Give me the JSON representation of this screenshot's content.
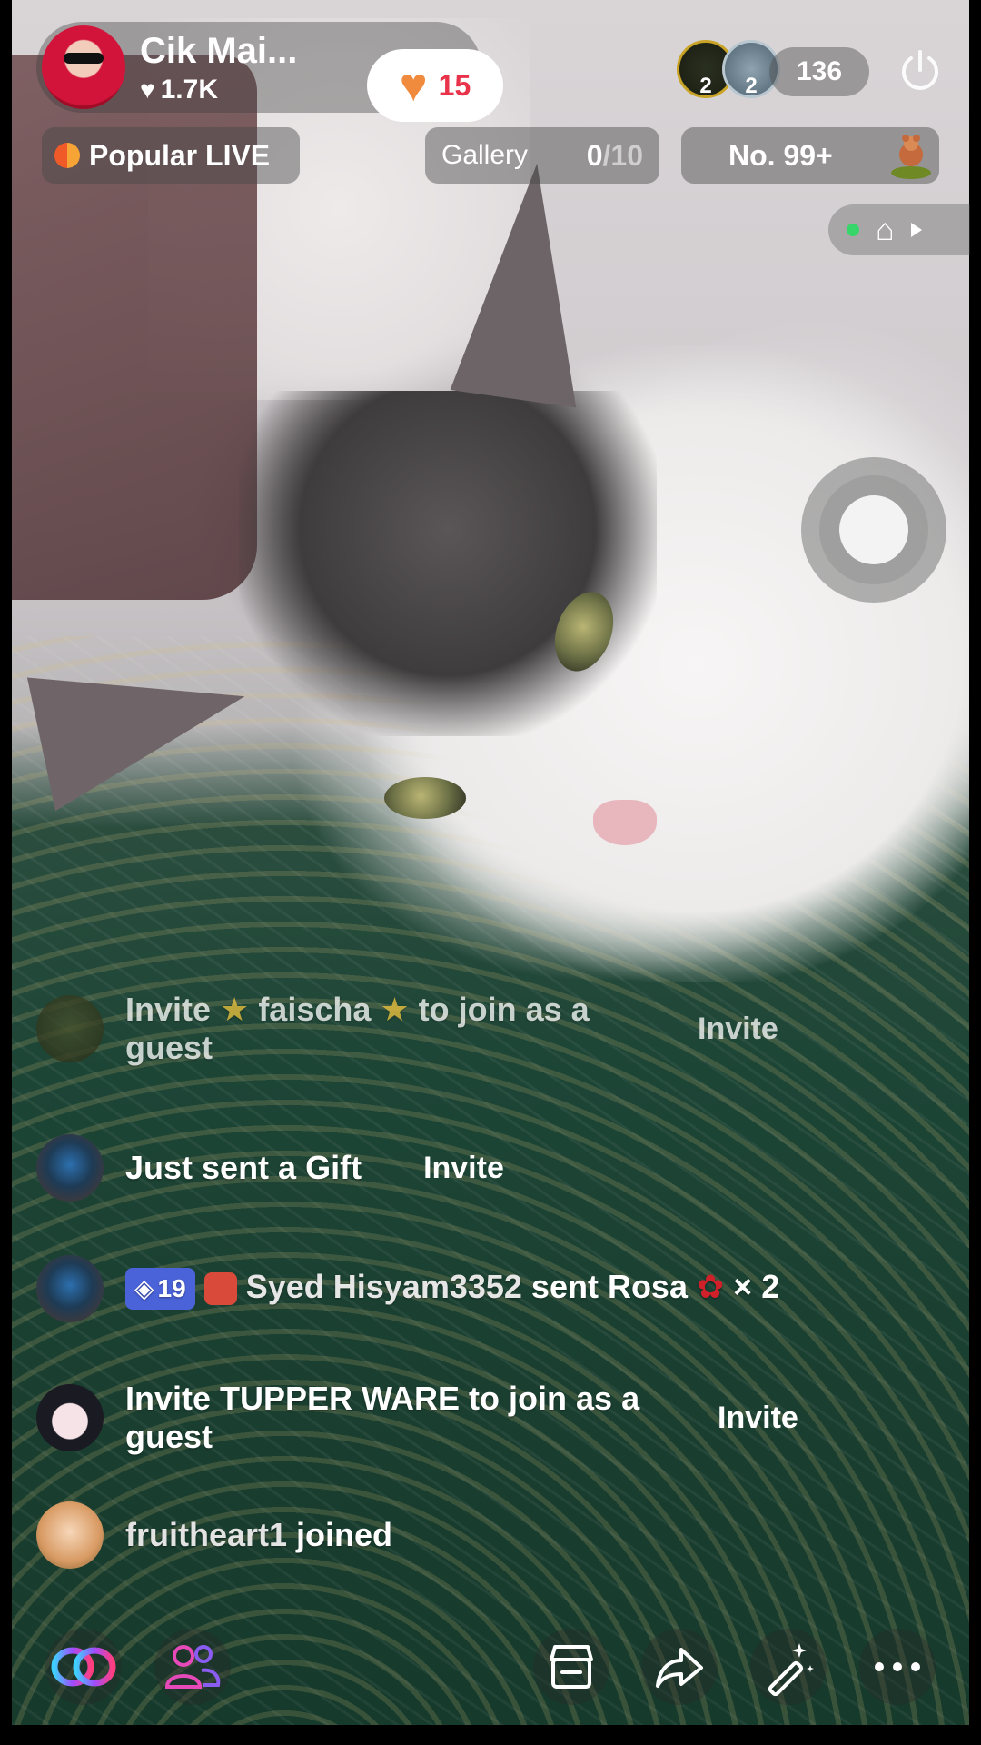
{
  "host": {
    "name": "Cik Mai...",
    "likes": "1.7K",
    "follow_count": "15"
  },
  "viewers": {
    "top1_rank": "2",
    "top2_rank": "2",
    "count": "136"
  },
  "chips": {
    "popular_label": "Popular LIVE",
    "gallery_label": "Gallery",
    "gallery_current": "0",
    "gallery_total": "/10",
    "rank_label": "No. 99+"
  },
  "chat": [
    {
      "pre": "Invite ",
      "name": " faischa ",
      "post": " to join as a",
      "line2": "guest",
      "action": "Invite"
    },
    {
      "text": "Just sent a Gift",
      "action": "Invite"
    },
    {
      "level": "19",
      "name": "Syed Hisyam3352",
      "text": " sent Rosa",
      "times": " × 2"
    },
    {
      "line1": "Invite TUPPER WARE to join as a",
      "line2": "guest",
      "action": "Invite"
    },
    {
      "name": "fruitheart1",
      "text": " joined"
    }
  ],
  "colors": {
    "follow_heart": "#f08a3c",
    "follow_count": "#e8334a",
    "level_badge": "#4b63d9",
    "mini_status": "#37d66b"
  },
  "icons": {
    "power": "power-icon",
    "house": "house-icon",
    "collab": "link-icon",
    "guests": "people-icon",
    "shop": "shop-icon",
    "share": "share-icon",
    "magic": "magic-wand-icon",
    "more": "more-icon"
  }
}
